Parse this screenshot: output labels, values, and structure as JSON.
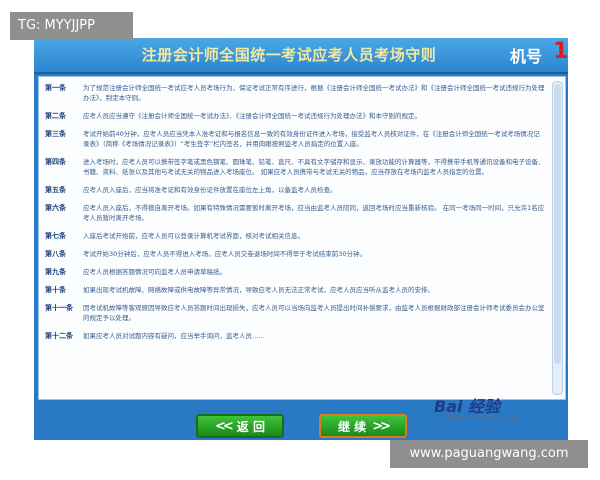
{
  "overlay_tag": "TG: MYYJJPP",
  "header": {
    "title": "注册会计师全国统一考试应考人员考场守则",
    "machine_label": "机号",
    "machine_number": "1"
  },
  "rules": [
    {
      "label": "第一条",
      "text": "为了规范注册会计师全国统一考试应考人员考场行为，保证考试正常有序进行，根据《注册会计师全国统一考试办法》和《注册会计师全国统一考试违规行为处理办法》，制定本守则。"
    },
    {
      "label": "第二条",
      "text": "应考人员应当遵守《注册会计师全国统一考试办法》、《注册会计师全国统一考试违规行为处理办法》和本守则的规定。"
    },
    {
      "label": "第三条",
      "text": "考试开始前40分钟，应考人员应当凭本人准考证和与报名信息一致的有效身份证件进入考场，接受监考人员核对证件，在《注册会计师全国统一考试考场情况记录表》（简称《考场情况记录表》）“考生签字”栏内签名，并用肉眼按照监考人员指定的位置入座。"
    },
    {
      "label": "第四条",
      "text": "进入考场时，应考人员可以携带签字笔或黑色钢笔、圆珠笔、铅笔、直尺、不具有文字储存和显示、录放功能的计算器等，不得携带手机等通讯设备和电子设备、书籍、资料、纸张以及其他与考试无关的物品进入考场座位。 如果应考人员携带与考试无关的物品，应当存放在考场内监考人员指定的位置。"
    },
    {
      "label": "第五条",
      "text": "应考人员入座后，应当将准考证和有效身份证件放置在座位左上角，以备监考人员检查。"
    },
    {
      "label": "第六条",
      "text": "应考人员入座后，不得擅自离开考场。如果有特殊情况需要暂时离开考场，应当由监考人员陪同，返回考场时应当重新核验。 在同一考场同一时间，只允许1名应考人员暂时离开考场。"
    },
    {
      "label": "第七条",
      "text": "入座后考试开始前，应考人员可以登录计算机考试界面，核对考试相关信息。"
    },
    {
      "label": "第八条",
      "text": "考试开始30分钟后，应考人员不得进入考场。应考人员交卷退场时间不得早于考试结束前30分钟。"
    },
    {
      "label": "第九条",
      "text": "应考人员根据答题情况可向监考人员申请草稿纸。"
    },
    {
      "label": "第十条",
      "text": "如果出现考试机故障、网络故障或供电故障等异常情况，导致应考人员无法正常考试，应考人员应当听从监考人员的安排。"
    },
    {
      "label": "第十一条",
      "text": "因考试机故障等客观原因导致应考人员答题时间出现损失，应考人员可以当场向监考人员提出时间补偿要求，由监考人员根据财政部注册会计师考试委员会办公室的规定予以处理。"
    },
    {
      "label": "第十二条",
      "text": "如果应考人员对试题内容有疑问，应当举手询问，监考人员……"
    }
  ],
  "buttons": {
    "back_label": "返 回",
    "continue_label": "继 续"
  },
  "watermark": {
    "baidu_text": "Bai 经验",
    "baidu_url": "jingyan.baidu.com",
    "site": "www.paguangwang.com"
  },
  "colors": {
    "header_blue": "#2d86cf",
    "title_yellow": "#f2e9a0",
    "machine_number_red": "#d81f1f",
    "button_green": "#198a1c",
    "continue_border_orange": "#e07a17"
  }
}
